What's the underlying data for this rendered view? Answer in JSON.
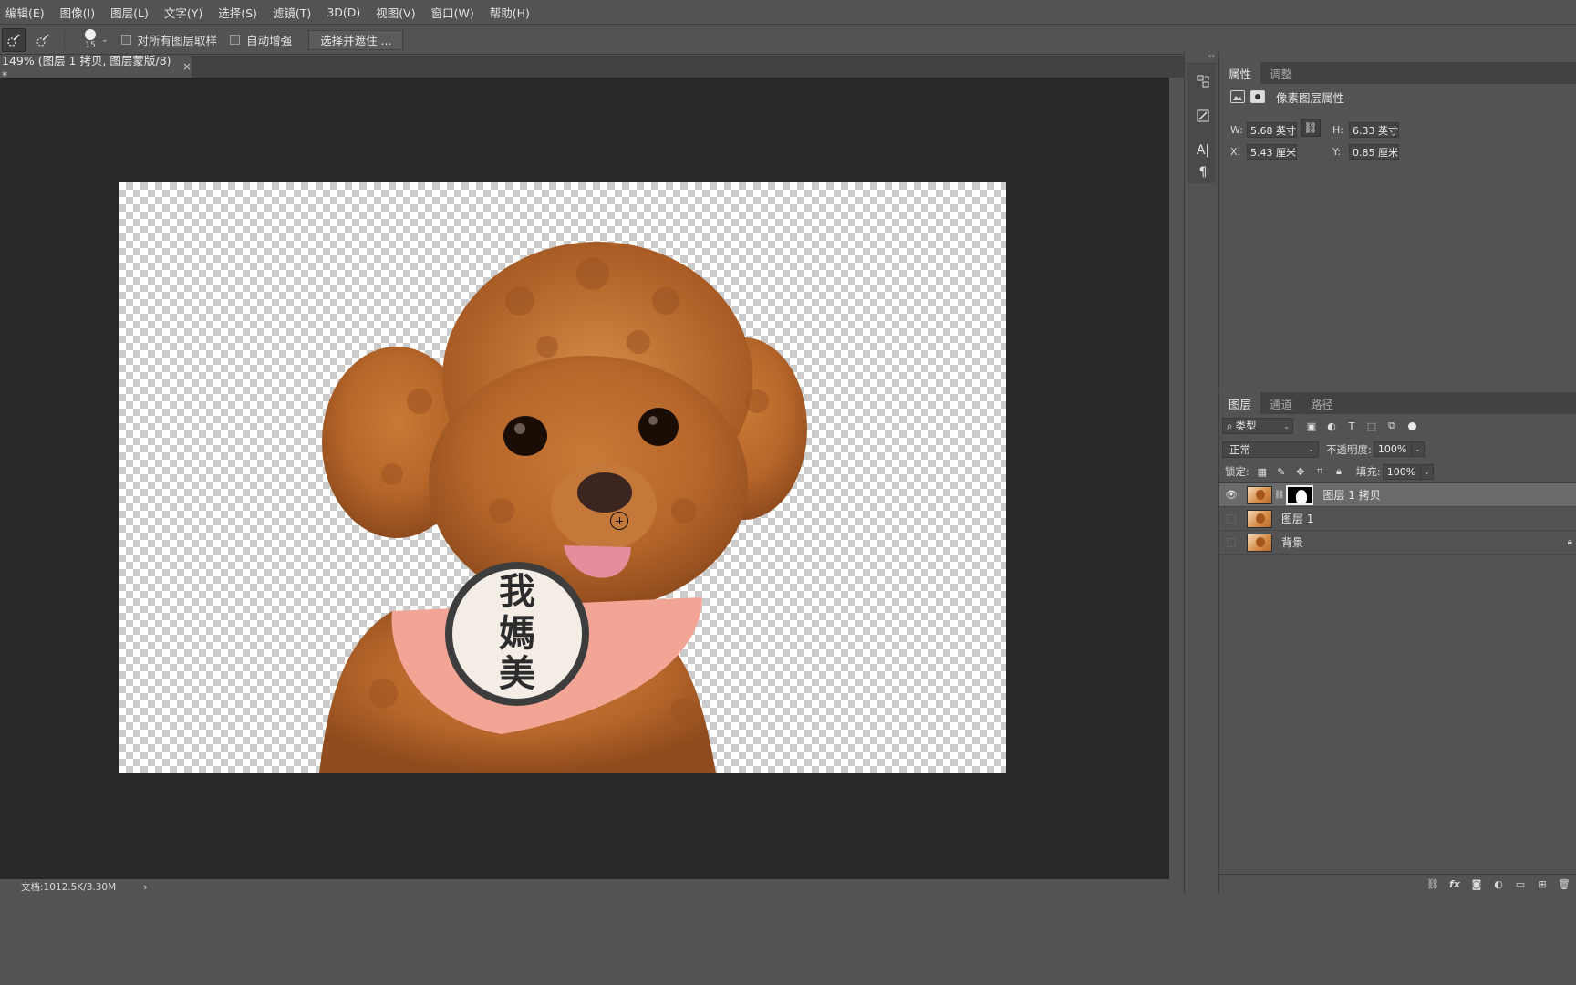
{
  "menu": [
    "编辑(E)",
    "图像(I)",
    "图层(L)",
    "文字(Y)",
    "选择(S)",
    "滤镜(T)",
    "3D(D)",
    "视图(V)",
    "窗口(W)",
    "帮助(H)"
  ],
  "options": {
    "brush_size": "15",
    "sample_all_layers": "对所有图层取样",
    "auto_enhance": "自动增强",
    "select_mask_button": "选择并遮住 ..."
  },
  "document": {
    "tab_title": "149% (图层 1 拷贝, 图层蒙版/8) *",
    "close": "×",
    "status": "文档:1012.5K/3.30M",
    "status_arrow": "›"
  },
  "image": {
    "description_icon": "poodle-cutout",
    "bib_text": [
      "我",
      "媽",
      "美"
    ]
  },
  "properties": {
    "tabs": [
      "属性",
      "调整"
    ],
    "title": "像素图层属性",
    "w_label": "W:",
    "w_value": "5.68 英寸",
    "h_label": "H:",
    "h_value": "6.33 英寸",
    "x_label": "X:",
    "x_value": "5.43 厘米",
    "y_label": "Y:",
    "y_value": "0.85 厘米"
  },
  "layers_panel": {
    "tabs": [
      "图层",
      "通道",
      "路径"
    ],
    "filter": "类型",
    "blend_mode": "正常",
    "opacity_label": "不透明度:",
    "opacity": "100%",
    "lock_label": "锁定:",
    "fill_label": "填充:",
    "fill": "100%",
    "layers": [
      {
        "name": "图层 1 拷贝",
        "visible": true,
        "has_mask": true,
        "selected": true,
        "locked": false
      },
      {
        "name": "图层 1",
        "visible": false,
        "has_mask": false,
        "selected": false,
        "locked": false
      },
      {
        "name": "背景",
        "visible": false,
        "has_mask": false,
        "selected": false,
        "locked": true
      }
    ]
  },
  "colors": {
    "ui_bg": "#535353",
    "canvas_bg": "#282828",
    "selected_layer": "#6a6a6a"
  }
}
